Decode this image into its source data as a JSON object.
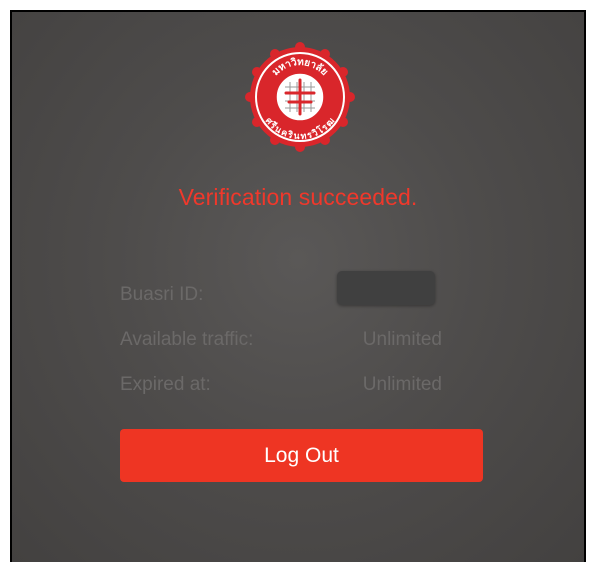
{
  "logo": {
    "name": "university-seal",
    "text_top": "มหาวิทยาลัย",
    "text_bottom": "ศรีนครินทรวิโรฒ",
    "colors": {
      "red": "#d9262b",
      "white": "#ffffff"
    }
  },
  "status": {
    "message": "Verification succeeded.",
    "color": "#f0382b"
  },
  "account": {
    "rows": [
      {
        "label": "Buasri ID:",
        "value": ""
      },
      {
        "label": "Available traffic:",
        "value": "Unlimited"
      },
      {
        "label": "Expired at:",
        "value": "Unlimited"
      }
    ]
  },
  "actions": {
    "logout_label": "Log Out",
    "logout_color": "#ee3523"
  }
}
